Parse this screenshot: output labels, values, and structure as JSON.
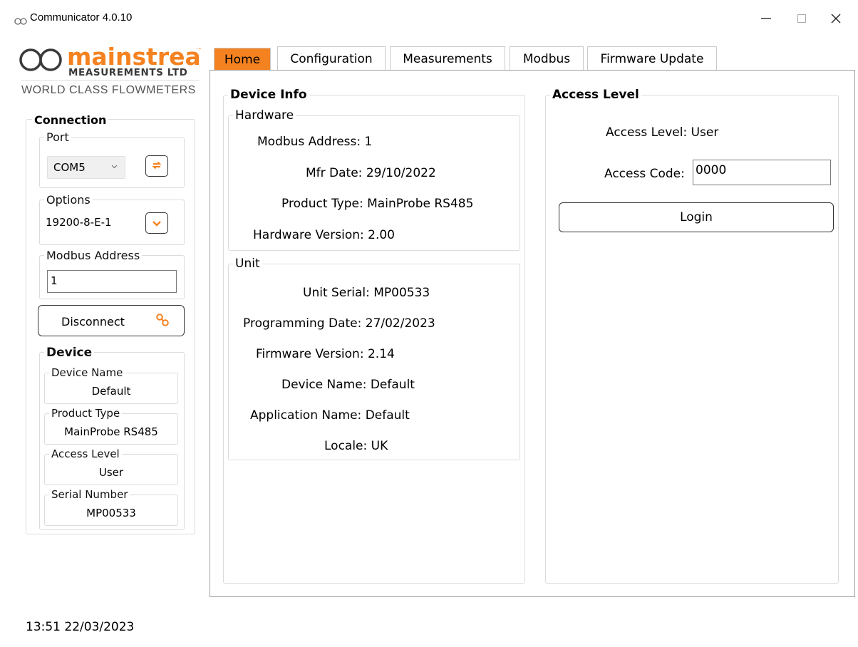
{
  "window": {
    "title": "Communicator 4.0.10",
    "min_label": "—",
    "max_label": "☐",
    "close_label": "✕"
  },
  "logo": {
    "brand": "mainstream",
    "tm": "™",
    "subtitle": "MEASUREMENTS LTD",
    "tagline": "WORLD CLASS FLOWMETERS",
    "accent": "#f58220"
  },
  "connection": {
    "title": "Connection",
    "port": {
      "label": "Port",
      "value": "COM5"
    },
    "options": {
      "label": "Options",
      "value": "19200-8-E-1"
    },
    "modbus_address": {
      "label": "Modbus Address",
      "value": "1"
    },
    "disconnect_label": "Disconnect"
  },
  "device": {
    "title": "Device",
    "fields": [
      {
        "label": "Device Name",
        "value": "Default"
      },
      {
        "label": "Product Type",
        "value": "MainProbe RS485"
      },
      {
        "label": "Access Level",
        "value": "User"
      },
      {
        "label": "Serial Number",
        "value": "MP00533"
      }
    ]
  },
  "tabs": [
    {
      "label": "Home",
      "active": true
    },
    {
      "label": "Configuration",
      "active": false
    },
    {
      "label": "Measurements",
      "active": false
    },
    {
      "label": "Modbus",
      "active": false
    },
    {
      "label": "Firmware Update",
      "active": false
    }
  ],
  "device_info": {
    "title": "Device Info",
    "hardware": {
      "title": "Hardware",
      "rows": [
        {
          "label": "Modbus Address:",
          "value": "1"
        },
        {
          "label": "Mfr Date:",
          "value": "29/10/2022"
        },
        {
          "label": "Product Type:",
          "value": "MainProbe RS485"
        },
        {
          "label": "Hardware Version:",
          "value": "2.00"
        }
      ]
    },
    "unit": {
      "title": "Unit",
      "rows": [
        {
          "label": "Unit Serial:",
          "value": "MP00533"
        },
        {
          "label": "Programming Date:",
          "value": "27/02/2023"
        },
        {
          "label": "Firmware Version:",
          "value": "2.14"
        },
        {
          "label": "Device Name:",
          "value": "Default"
        },
        {
          "label": "Application Name:",
          "value": "Default"
        },
        {
          "label": "Locale:",
          "value": "UK"
        }
      ]
    }
  },
  "access": {
    "title": "Access Level",
    "level_label": "Access Level:",
    "level_value": "User",
    "code_label": "Access Code:",
    "code_value": "0000",
    "login_label": "Login"
  },
  "status": {
    "datetime": "13:51 22/03/2023"
  }
}
